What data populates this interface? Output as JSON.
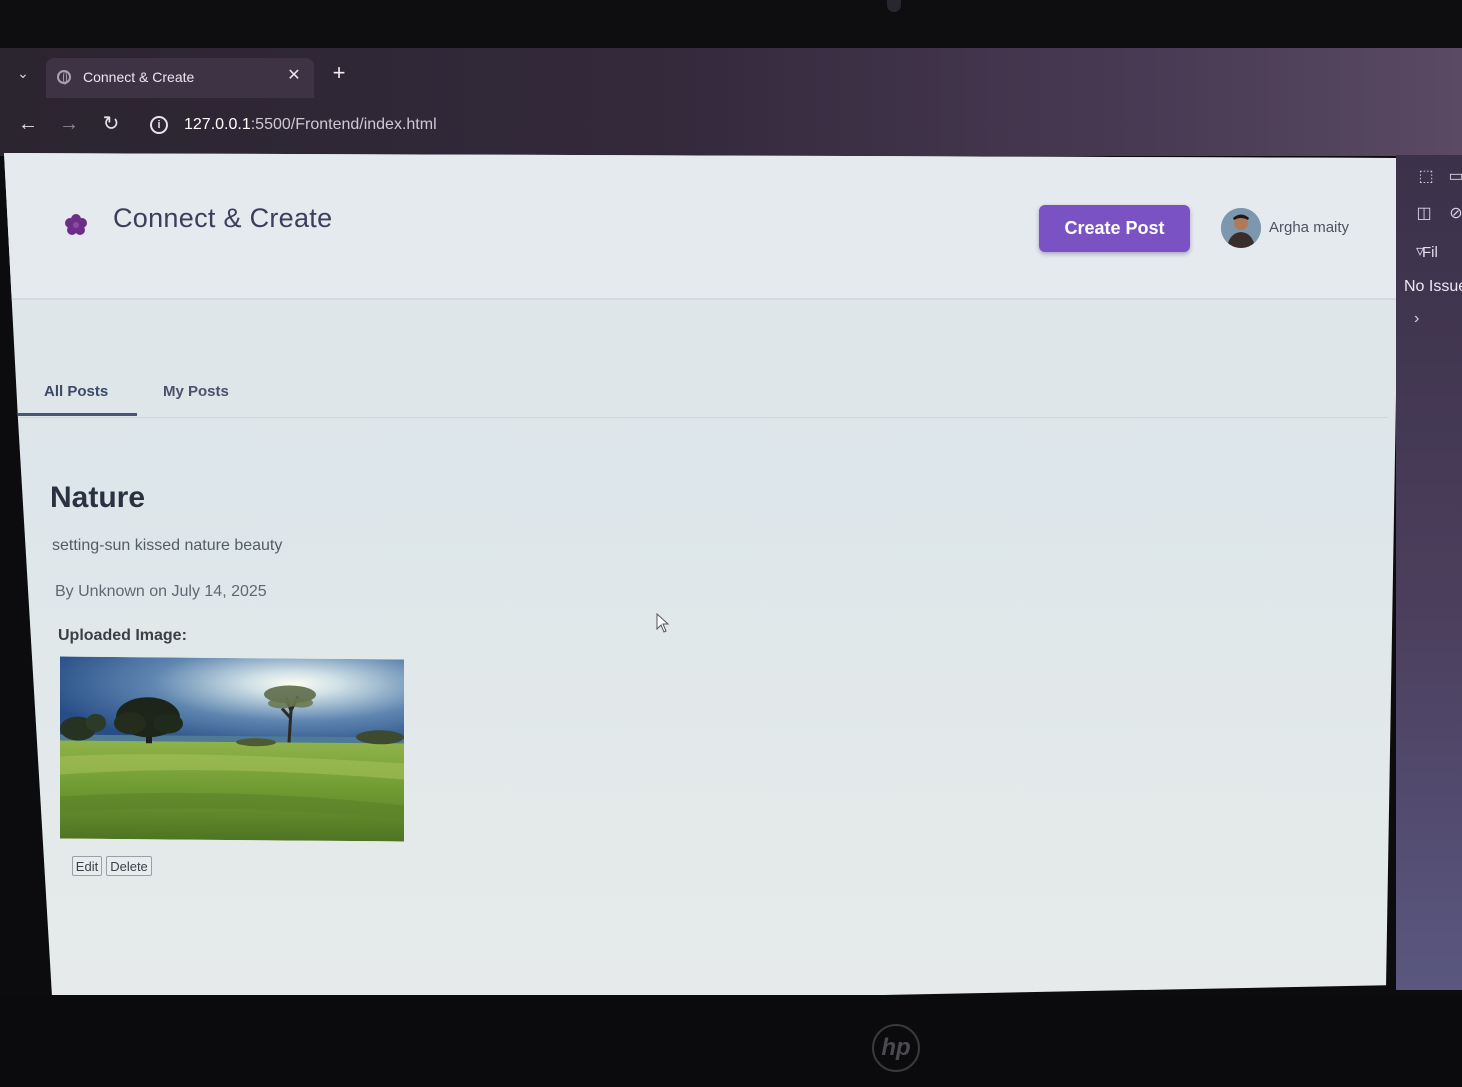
{
  "browser": {
    "tab_title": "Connect & Create",
    "url_host": "127.0.0.1",
    "url_path": ":5500/Frontend/index.html"
  },
  "header": {
    "brand": "Connect & Create",
    "create_button": "Create Post",
    "username": "Argha maity"
  },
  "tabs": [
    {
      "label": "All Posts",
      "active": true
    },
    {
      "label": "My Posts",
      "active": false
    }
  ],
  "post": {
    "title": "Nature",
    "description": "setting-sun kissed nature beauty",
    "meta": "By Unknown on July 14, 2025",
    "image_label": "Uploaded Image:",
    "edit_label": "Edit",
    "delete_label": "Delete"
  },
  "devtools": {
    "filter_label": "Fil",
    "issues_text": "No Issue"
  },
  "laptop": {
    "logo": "hp"
  },
  "colors": {
    "accent": "#7b52c4",
    "page_background": "#e0e7eb",
    "title_text": "#3b3f5c"
  }
}
